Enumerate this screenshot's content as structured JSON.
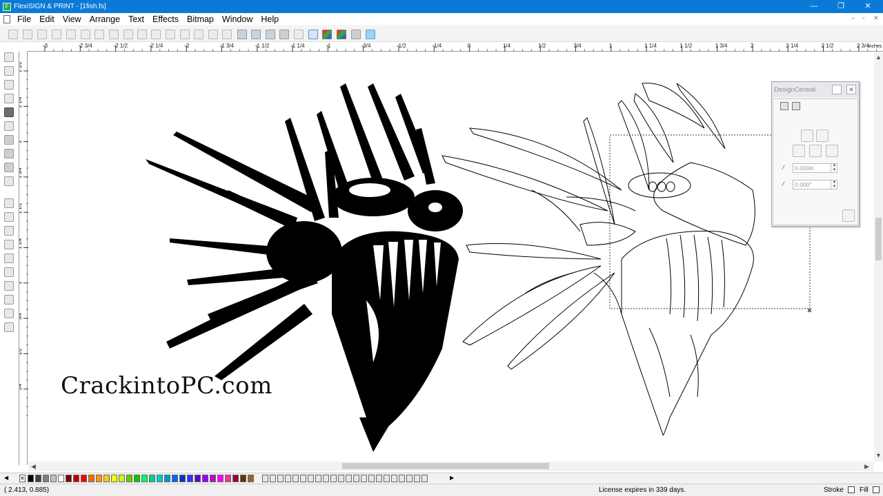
{
  "window": {
    "title": "FlexiSIGN & PRINT - [1fish.fs]",
    "minimize": "—",
    "maximize": "❐",
    "close": "✕",
    "doc_minimize": "–",
    "doc_restore": "▫",
    "doc_close": "✕"
  },
  "menu": [
    "File",
    "Edit",
    "View",
    "Arrange",
    "Text",
    "Effects",
    "Bitmap",
    "Window",
    "Help"
  ],
  "ruler": {
    "units": "inches",
    "h_labels": [
      "-3",
      "-2 3/4",
      "-2 1/2",
      "-2 1/4",
      "-2",
      "-1 3/4",
      "-1 1/2",
      "-1 1/4",
      "-1",
      "-3/4",
      "-1/2",
      "-1/4",
      "0",
      "1/4",
      "1/2",
      "3/4",
      "1",
      "1 1/4",
      "1 1/2",
      "1 3/4",
      "2",
      "2 1/4",
      "2 1/2",
      "2 3/4"
    ],
    "v_labels": [
      "2 1/2",
      "2 1/4",
      "2",
      "1 3/4",
      "1 1/2",
      "1 1/4",
      "1",
      "3/4",
      "1/2",
      "1/4"
    ]
  },
  "design_central": {
    "title": "DesignCentral",
    "field1": "0.000in",
    "field2": "0.000°"
  },
  "watermark": "CrackintoPC.com",
  "status": {
    "coords": "( 2.413,       0.885)",
    "license": "License expires in 339 days.",
    "stroke": "Stroke",
    "fill": "Fill"
  },
  "palette_colors": [
    "#000000",
    "#404040",
    "#808080",
    "#c0c0c0",
    "#ffffff",
    "#800000",
    "#c00000",
    "#ff0000",
    "#ff6600",
    "#ff9900",
    "#ffcc00",
    "#ffff00",
    "#ccff00",
    "#66cc00",
    "#00cc00",
    "#00ff66",
    "#00cc99",
    "#00cccc",
    "#0099cc",
    "#0066ff",
    "#0033cc",
    "#3333ff",
    "#6600cc",
    "#9900ff",
    "#cc00cc",
    "#ff00ff",
    "#ff3399",
    "#990033",
    "#663300",
    "#996633"
  ]
}
